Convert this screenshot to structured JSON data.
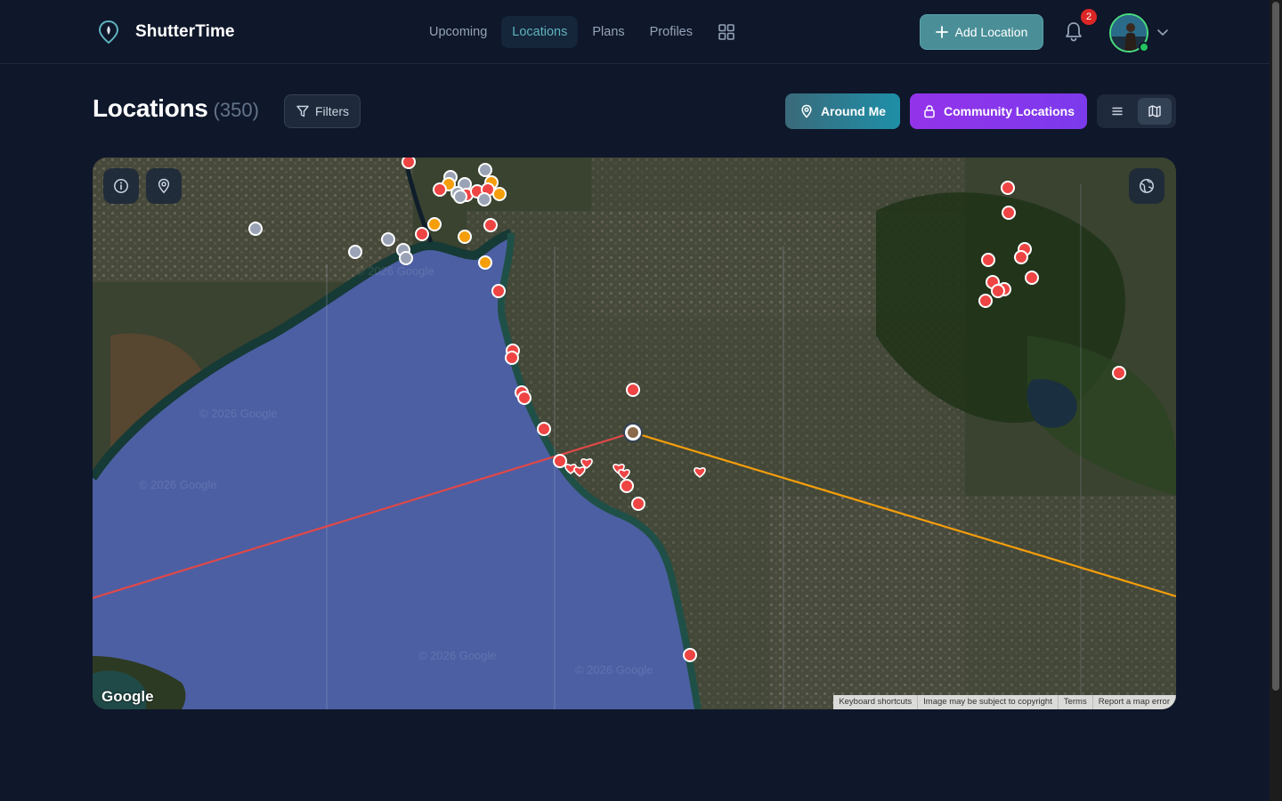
{
  "app": {
    "name": "ShutterTime"
  },
  "nav": {
    "items": [
      {
        "label": "Upcoming",
        "active": false
      },
      {
        "label": "Locations",
        "active": true
      },
      {
        "label": "Plans",
        "active": false
      },
      {
        "label": "Profiles",
        "active": false
      }
    ],
    "grid_icon": "grid-icon"
  },
  "header": {
    "add_location_label": "Add Location",
    "notification_count": "2"
  },
  "page": {
    "title": "Locations",
    "count": "(350)",
    "filters_label": "Filters",
    "around_me_label": "Around Me",
    "community_label": "Community Locations"
  },
  "map": {
    "google_label": "Google",
    "attribution": [
      "Keyboard shortcuts",
      "Image may be subject to copyright",
      "Terms",
      "Report a map error"
    ],
    "watermarks": [
      "© 2026 Google",
      "© 2026 Google",
      "© 2026 Google",
      "© 2026 Google",
      "© 2026 Google"
    ]
  },
  "colors": {
    "accent": "#5fb3bf",
    "add_button": "#4a8f98",
    "community": "#9333ea",
    "marker_red": "#ef4444",
    "marker_orange": "#f59e0b",
    "marker_grey": "#9aa3b5",
    "sun_line": "#f59e0b",
    "moon_line": "#e04848"
  }
}
